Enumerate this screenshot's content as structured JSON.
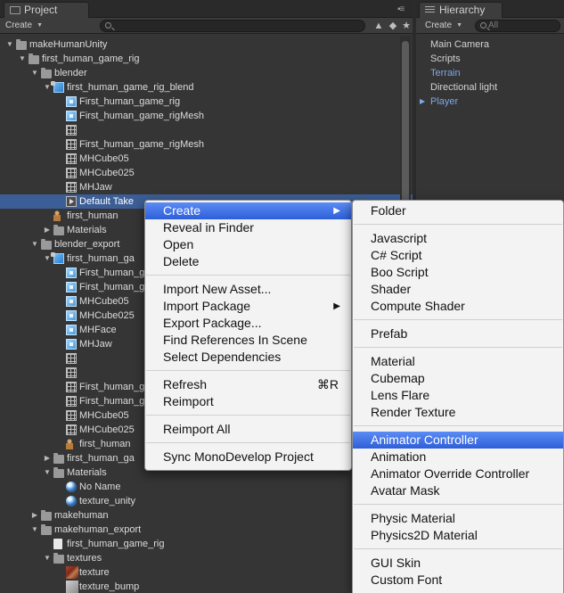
{
  "project": {
    "tab_title": "Project",
    "create_label": "Create",
    "tree": [
      {
        "label": "makeHumanUnity",
        "icon": "folder-icon",
        "arrow": "▼",
        "depth": 0
      },
      {
        "label": "first_human_game_rig",
        "icon": "folder-icon",
        "arrow": "▼",
        "depth": 1
      },
      {
        "label": "blender",
        "icon": "folder-icon",
        "arrow": "▼",
        "depth": 2
      },
      {
        "label": "first_human_game_rig_blend",
        "icon": "model-icon",
        "arrow": "▼",
        "depth": 3
      },
      {
        "label": "First_human_game_rig",
        "icon": "mesh-icon",
        "arrow": "",
        "depth": 4
      },
      {
        "label": "First_human_game_rigMesh",
        "icon": "mesh-icon",
        "arrow": "",
        "depth": 4
      },
      {
        "label": "",
        "icon": "bone-icon",
        "arrow": "",
        "depth": 4
      },
      {
        "label": "First_human_game_rigMesh",
        "icon": "bone-icon",
        "arrow": "",
        "depth": 4
      },
      {
        "label": "MHCube05",
        "icon": "bone-icon",
        "arrow": "",
        "depth": 4
      },
      {
        "label": "MHCube025",
        "icon": "bone-icon",
        "arrow": "",
        "depth": 4
      },
      {
        "label": "MHJaw",
        "icon": "bone-icon",
        "arrow": "",
        "depth": 4
      },
      {
        "label": "Default Take",
        "icon": "animation-clip-icon",
        "arrow": "",
        "depth": 4,
        "selected": true
      },
      {
        "label": "first_human",
        "icon": "avatar-icon",
        "arrow": "",
        "depth": 3
      },
      {
        "label": "Materials",
        "icon": "folder-icon",
        "arrow": "▶",
        "depth": 3
      },
      {
        "label": "blender_export",
        "icon": "folder-icon",
        "arrow": "▼",
        "depth": 2
      },
      {
        "label": "first_human_ga",
        "icon": "model-icon",
        "arrow": "▼",
        "depth": 3
      },
      {
        "label": "First_human_ga",
        "icon": "mesh-icon",
        "arrow": "",
        "depth": 4
      },
      {
        "label": "First_human_ga",
        "icon": "mesh-icon",
        "arrow": "",
        "depth": 4
      },
      {
        "label": "MHCube05",
        "icon": "mesh-icon",
        "arrow": "",
        "depth": 4
      },
      {
        "label": "MHCube025",
        "icon": "mesh-icon",
        "arrow": "",
        "depth": 4
      },
      {
        "label": "MHFace",
        "icon": "mesh-icon",
        "arrow": "",
        "depth": 4
      },
      {
        "label": "MHJaw",
        "icon": "mesh-icon",
        "arrow": "",
        "depth": 4
      },
      {
        "label": "",
        "icon": "bone-icon",
        "arrow": "",
        "depth": 4
      },
      {
        "label": "",
        "icon": "bone-icon",
        "arrow": "",
        "depth": 4
      },
      {
        "label": "First_human_ga",
        "icon": "bone-icon",
        "arrow": "",
        "depth": 4
      },
      {
        "label": "First_human_ga",
        "icon": "bone-icon",
        "arrow": "",
        "depth": 4
      },
      {
        "label": "MHCube05",
        "icon": "bone-icon",
        "arrow": "",
        "depth": 4
      },
      {
        "label": "MHCube025",
        "icon": "bone-icon",
        "arrow": "",
        "depth": 4
      },
      {
        "label": "first_human",
        "icon": "avatar-icon",
        "arrow": "",
        "depth": 4
      },
      {
        "label": "first_human_ga",
        "icon": "folder-icon",
        "arrow": "▶",
        "depth": 3
      },
      {
        "label": "Materials",
        "icon": "folder-icon",
        "arrow": "▼",
        "depth": 3
      },
      {
        "label": "No Name",
        "icon": "material-icon",
        "arrow": "",
        "depth": 4
      },
      {
        "label": "texture_unity",
        "icon": "material-icon",
        "arrow": "",
        "depth": 4
      },
      {
        "label": "makehuman",
        "icon": "folder-icon",
        "arrow": "▶",
        "depth": 2
      },
      {
        "label": "makehuman_export",
        "icon": "folder-icon",
        "arrow": "▼",
        "depth": 2
      },
      {
        "label": "first_human_game_rig",
        "icon": "document-icon",
        "arrow": "",
        "depth": 3
      },
      {
        "label": "textures",
        "icon": "folder-icon",
        "arrow": "▼",
        "depth": 3
      },
      {
        "label": "texture",
        "icon": "texture-icon",
        "arrow": "",
        "depth": 4
      },
      {
        "label": "texture_bump",
        "icon": "texture-bump-icon",
        "arrow": "",
        "depth": 4
      }
    ]
  },
  "hierarchy": {
    "tab_title": "Hierarchy",
    "create_label": "Create",
    "search_placeholder": "All",
    "items": [
      {
        "label": "Main Camera",
        "prefab": false,
        "arrow": ""
      },
      {
        "label": "Scripts",
        "prefab": false,
        "arrow": ""
      },
      {
        "label": "Terrain",
        "prefab": true,
        "arrow": ""
      },
      {
        "label": "Directional light",
        "prefab": false,
        "arrow": ""
      },
      {
        "label": "Player",
        "prefab": true,
        "arrow": "▶"
      }
    ]
  },
  "context_menu": {
    "items": [
      {
        "type": "item",
        "label": "Create",
        "submenu": true,
        "highlighted": true
      },
      {
        "type": "item",
        "label": "Reveal in Finder"
      },
      {
        "type": "item",
        "label": "Open"
      },
      {
        "type": "item",
        "label": "Delete"
      },
      {
        "type": "sep"
      },
      {
        "type": "item",
        "label": "Import New Asset..."
      },
      {
        "type": "item",
        "label": "Import Package",
        "submenu": true
      },
      {
        "type": "item",
        "label": "Export Package..."
      },
      {
        "type": "item",
        "label": "Find References In Scene"
      },
      {
        "type": "item",
        "label": "Select Dependencies"
      },
      {
        "type": "sep"
      },
      {
        "type": "item",
        "label": "Refresh",
        "shortcut": "⌘R"
      },
      {
        "type": "item",
        "label": "Reimport"
      },
      {
        "type": "sep"
      },
      {
        "type": "item",
        "label": "Reimport All"
      },
      {
        "type": "sep"
      },
      {
        "type": "item",
        "label": "Sync MonoDevelop Project"
      }
    ]
  },
  "create_submenu": {
    "items": [
      {
        "type": "item",
        "label": "Folder"
      },
      {
        "type": "sep"
      },
      {
        "type": "item",
        "label": "Javascript"
      },
      {
        "type": "item",
        "label": "C# Script"
      },
      {
        "type": "item",
        "label": "Boo Script"
      },
      {
        "type": "item",
        "label": "Shader"
      },
      {
        "type": "item",
        "label": "Compute Shader"
      },
      {
        "type": "sep"
      },
      {
        "type": "item",
        "label": "Prefab"
      },
      {
        "type": "sep"
      },
      {
        "type": "item",
        "label": "Material"
      },
      {
        "type": "item",
        "label": "Cubemap"
      },
      {
        "type": "item",
        "label": "Lens Flare"
      },
      {
        "type": "item",
        "label": "Render Texture"
      },
      {
        "type": "sep"
      },
      {
        "type": "item",
        "label": "Animator Controller",
        "highlighted": true
      },
      {
        "type": "item",
        "label": "Animation"
      },
      {
        "type": "item",
        "label": "Animator Override Controller"
      },
      {
        "type": "item",
        "label": "Avatar Mask"
      },
      {
        "type": "sep"
      },
      {
        "type": "item",
        "label": "Physic Material"
      },
      {
        "type": "item",
        "label": "Physics2D Material"
      },
      {
        "type": "sep"
      },
      {
        "type": "item",
        "label": "GUI Skin"
      },
      {
        "type": "item",
        "label": "Custom Font"
      }
    ]
  },
  "colors": {
    "selection": "#3c5e96",
    "menu_highlight": "#3f6fe0",
    "prefab_text": "#7da7e6"
  }
}
